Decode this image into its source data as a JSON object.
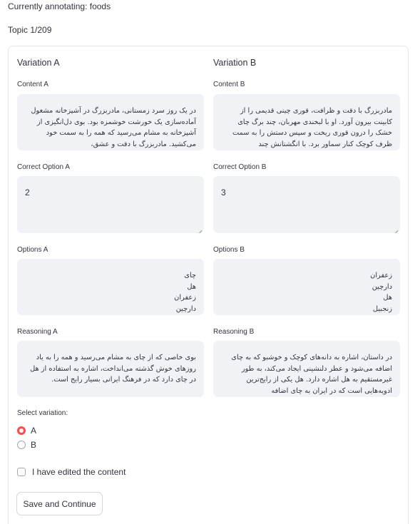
{
  "header": {
    "annotating": "Currently annotating: foods",
    "topic": "Topic 1/209"
  },
  "variation_a": {
    "title": "Variation A",
    "content_label": "Content A",
    "content": "در یک روز سرد زمستانی، مادربزرگ در آشپزخانه مشغول آماده‌سازی یک خورشت خوشمزه بود. بوی دل‌انگیزی از آشپزخانه به مشام می‌رسید که همه را به سمت خود می‌کشید. مادربزرگ با دقت و عشق،",
    "correct_label": "Correct Option A",
    "correct": "2",
    "options_label": "Options A",
    "options": "چای\nهل\nزعفران\nدارچین",
    "reasoning_label": "Reasoning A",
    "reasoning": "بوی خاصی که از چای به مشام می‌رسید و همه را به یاد روزهای خوش گذشته می‌انداخت، اشاره به استفاده از هل در چای دارد که در فرهنگ ایرانی بسیار رایج است."
  },
  "variation_b": {
    "title": "Variation B",
    "content_label": "Content B",
    "content": "مادربزرگ با دقت و ظرافت، قوری چینی قدیمی را از کابینت بیرون آورد. او با لبخندی مهربان، چند برگ چای خشک را درون قوری ریخت و سپس دستش را به سمت ظرف کوچک کنار سماور برد. با انگشتانش چند",
    "correct_label": "Correct Option B",
    "correct": "3",
    "options_label": "Options B",
    "options": "زعفران\nدارچین\nهل\nزنجبیل",
    "reasoning_label": "Reasoning B",
    "reasoning": "در داستان، اشاره به دانه‌های کوچک و خوشبو که به چای اضافه می‌شود و عطر دلنشینی ایجاد می‌کند، به طور غیرمستقیم به هل اشاره دارد. هل یکی از رایج‌ترین ادویه‌هایی است که در ایران به چای اضافه"
  },
  "select": {
    "label": "Select variation:",
    "options": [
      "A",
      "B"
    ],
    "selected": "A"
  },
  "edited": {
    "label": "I have edited the content",
    "checked": false
  },
  "save_button": "Save and Continue",
  "colors": {
    "accent": "#ff4b4b",
    "field_bg": "#f0f2f6",
    "text": "#31333f"
  }
}
